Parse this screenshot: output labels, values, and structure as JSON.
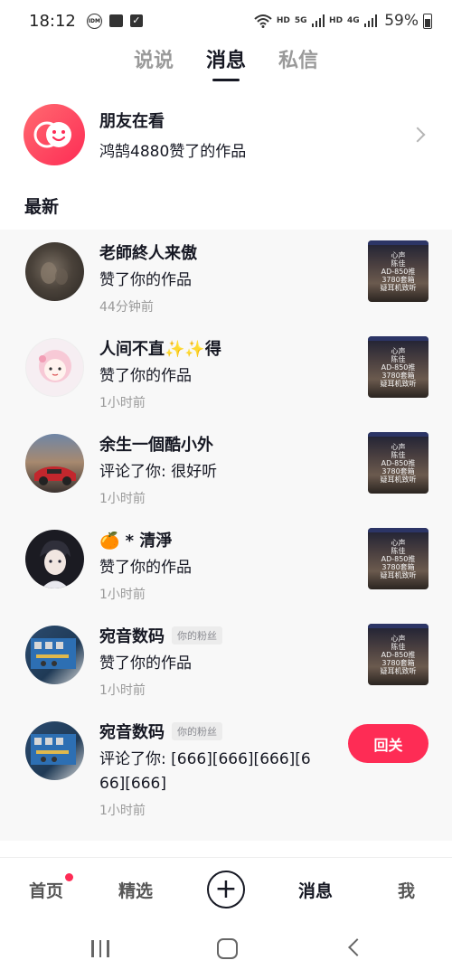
{
  "status_bar": {
    "time": "18:12",
    "icons": [
      "idm-icon",
      "clapper-icon",
      "check-icon"
    ],
    "network": [
      "HD",
      "5G",
      "HD",
      "4G"
    ],
    "battery": "59%"
  },
  "top_tabs": [
    {
      "label": "说说",
      "active": false
    },
    {
      "label": "消息",
      "active": true
    },
    {
      "label": "私信",
      "active": false
    }
  ],
  "friends": {
    "title": "朋友在看",
    "subtitle": "鸿鹄4880赞了的作品"
  },
  "section_title": "最新",
  "messages": [
    {
      "name": "老師終人来傲",
      "action": "赞了你的作品",
      "time": "44分钟前",
      "badge": "",
      "thumb": true
    },
    {
      "name": "人间不直✨✨得",
      "action": "赞了你的作品",
      "time": "1小时前",
      "badge": "",
      "thumb": true
    },
    {
      "name": "余生一個酷小外",
      "action": "评论了你: 很好听",
      "time": "1小时前",
      "badge": "",
      "thumb": true
    },
    {
      "name": "🍊 * 清淨",
      "action": "赞了你的作品",
      "time": "1小时前",
      "badge": "",
      "thumb": true
    },
    {
      "name": "宛音数码",
      "action": "赞了你的作品",
      "time": "1小时前",
      "badge": "你的粉丝",
      "thumb": true
    },
    {
      "name": "宛音数码",
      "action": "评论了你: [666][666][666][666][666]",
      "time": "1小时前",
      "badge": "你的粉丝",
      "thumb": false
    }
  ],
  "thumb_text": [
    "心声",
    "陈佳",
    "AD-850推",
    "3780套箱",
    "疑耳机致听"
  ],
  "reply_label": "回关",
  "bottom_nav": [
    {
      "label": "首页",
      "dot": true
    },
    {
      "label": "精选"
    },
    {
      "label": "+"
    },
    {
      "label": "消息",
      "active": true
    },
    {
      "label": "我"
    }
  ],
  "colors": {
    "accent": "#fe2c55",
    "text": "#161823",
    "list_bg": "#f8f8f8"
  }
}
